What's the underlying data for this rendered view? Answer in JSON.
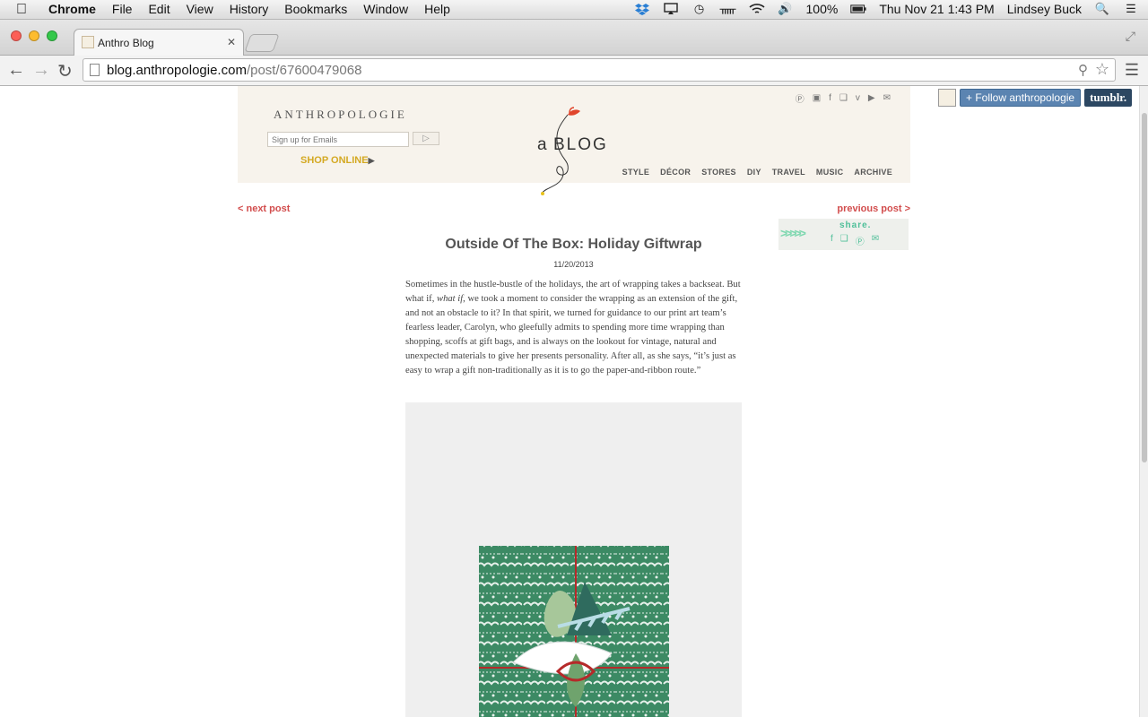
{
  "menubar": {
    "app_name": "Chrome",
    "menus": [
      "File",
      "Edit",
      "View",
      "History",
      "Bookmarks",
      "Window",
      "Help"
    ],
    "battery": "100%",
    "clock": "Thu Nov 21  1:43 PM",
    "user": "Lindsey Buck"
  },
  "browser": {
    "tab_title": "Anthro Blog",
    "url_host": "blog.anthropologie.com",
    "url_path": "/post/67600479068"
  },
  "header": {
    "brand": "ANTHROPOLOGIE",
    "email_placeholder": "Sign up for Emails",
    "shop_online": "SHOP ONLINE",
    "logo_a": "a",
    "logo_blog": "BLOG",
    "nav": [
      "STYLE",
      "DÉCOR",
      "STORES",
      "DIY",
      "TRAVEL",
      "MUSIC",
      "ARCHIVE"
    ]
  },
  "tumblr": {
    "follow_label": "+ Follow anthropologie",
    "logo": "tumblr."
  },
  "post_nav": {
    "next": "< next post",
    "previous": "previous post >"
  },
  "share": {
    "label": "share."
  },
  "post": {
    "title": "Outside Of The Box: Holiday Giftwrap",
    "date": "11/20/2013",
    "body_1": "Sometimes in the hustle-bustle of the holidays, the art of wrapping takes a backseat. But what if, ",
    "body_em": "what if",
    "body_2": ", we took a moment to consider the wrapping as an extension of the gift, and not an obstacle to it? In that spirit, we turned for guidance to our print art team’s fearless leader, Carolyn, who gleefully admits to spending more time wrapping than shopping, scoffs at gift bags, and is always on the lookout for vintage, natural and unexpected materials to give her presents personality. After all, as she says, “it’s just as easy to wrap a gift non-traditionally as it is to go the paper-and-ribbon route.”"
  },
  "colors": {
    "accent_red": "#d24d4d",
    "shop_gold": "#d4a922",
    "share_green": "#4fbf99",
    "gift_green": "#3c8a64"
  }
}
